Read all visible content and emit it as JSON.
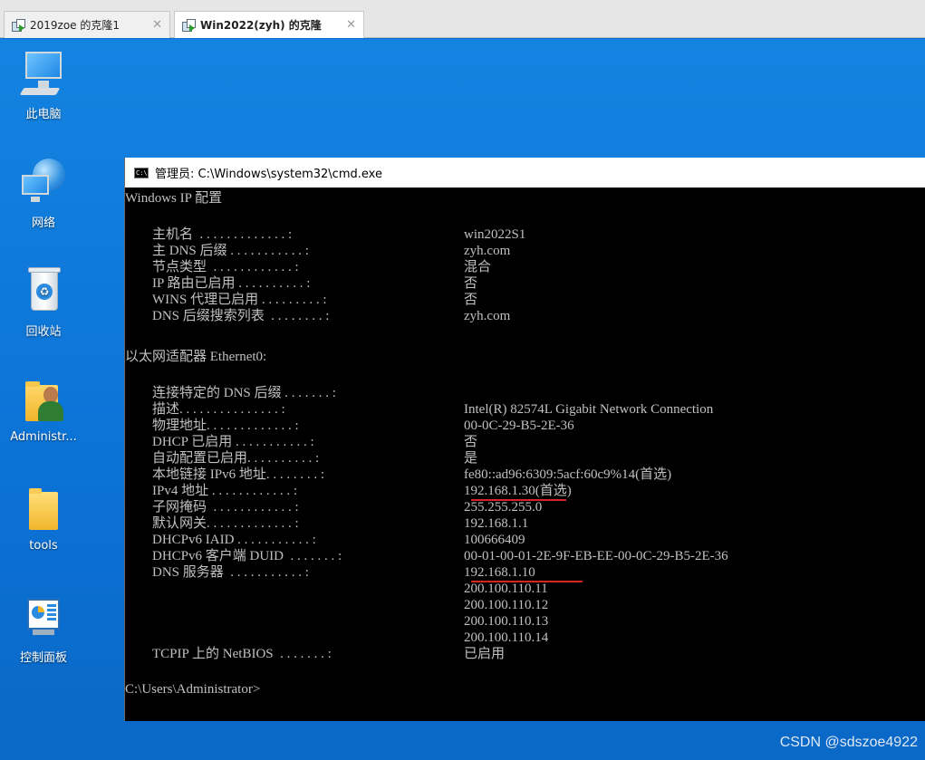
{
  "tabs": [
    {
      "label": "2019zoe 的克隆1",
      "active": false
    },
    {
      "label": "Win2022(zyh) 的克隆",
      "active": true
    }
  ],
  "desktop_icons": [
    {
      "label": "此电脑",
      "icon": "this-pc-icon"
    },
    {
      "label": "网络",
      "icon": "network-icon"
    },
    {
      "label": "回收站",
      "icon": "recycle-bin-icon"
    },
    {
      "label": "Administr...",
      "icon": "user-folder-icon"
    },
    {
      "label": "tools",
      "icon": "folder-icon"
    },
    {
      "label": "控制面板",
      "icon": "control-panel-icon"
    }
  ],
  "cmd": {
    "title": "管理员: C:\\Windows\\system32\\cmd.exe",
    "header": "Windows IP 配置",
    "ip_config": [
      {
        "key": "主机名  . . . . . . . . . . . . . :",
        "value": "win2022S1"
      },
      {
        "key": "主 DNS 后缀 . . . . . . . . . . . :",
        "value": "zyh.com"
      },
      {
        "key": "节点类型  . . . . . . . . . . . . :",
        "value": "混合"
      },
      {
        "key": "IP 路由已启用 . . . . . . . . . . :",
        "value": "否"
      },
      {
        "key": "WINS 代理已启用 . . . . . . . . . :",
        "value": "否"
      },
      {
        "key": "DNS 后缀搜索列表  . . . . . . . . :",
        "value": "zyh.com"
      }
    ],
    "adapter_header": "以太网适配器 Ethernet0:",
    "adapter": [
      {
        "key": "连接特定的 DNS 后缀 . . . . . . . :",
        "value": ""
      },
      {
        "key": "描述. . . . . . . . . . . . . . . :",
        "value": "Intel(R) 82574L Gigabit Network Connection"
      },
      {
        "key": "物理地址. . . . . . . . . . . . . :",
        "value": "00-0C-29-B5-2E-36"
      },
      {
        "key": "DHCP 已启用 . . . . . . . . . . . :",
        "value": "否"
      },
      {
        "key": "自动配置已启用. . . . . . . . . . :",
        "value": "是"
      },
      {
        "key": "本地链接 IPv6 地址. . . . . . . . :",
        "value": "fe80::ad96:6309:5acf:60c9%14(首选)"
      },
      {
        "key": "IPv4 地址 . . . . . . . . . . . . :",
        "value": "192.168.1.30(首选)"
      },
      {
        "key": "子网掩码  . . . . . . . . . . . . :",
        "value": "255.255.255.0"
      },
      {
        "key": "默认网关. . . . . . . . . . . . . :",
        "value": "192.168.1.1"
      },
      {
        "key": "DHCPv6 IAID . . . . . . . . . . . :",
        "value": "100666409"
      },
      {
        "key": "DHCPv6 客户端 DUID  . . . . . . . :",
        "value": "00-01-00-01-2E-9F-EB-EE-00-0C-29-B5-2E-36"
      },
      {
        "key": "DNS 服务器  . . . . . . . . . . . :",
        "value": "192.168.1.10"
      },
      {
        "key": "",
        "value": "200.100.110.11"
      },
      {
        "key": "",
        "value": "200.100.110.12"
      },
      {
        "key": "",
        "value": "200.100.110.13"
      },
      {
        "key": "",
        "value": "200.100.110.14"
      },
      {
        "key": "TCPIP 上的 NetBIOS  . . . . . . . :",
        "value": "已启用"
      }
    ],
    "prompt": "C:\\Users\\Administrator>"
  },
  "watermark": "CSDN @sdszoe4922"
}
